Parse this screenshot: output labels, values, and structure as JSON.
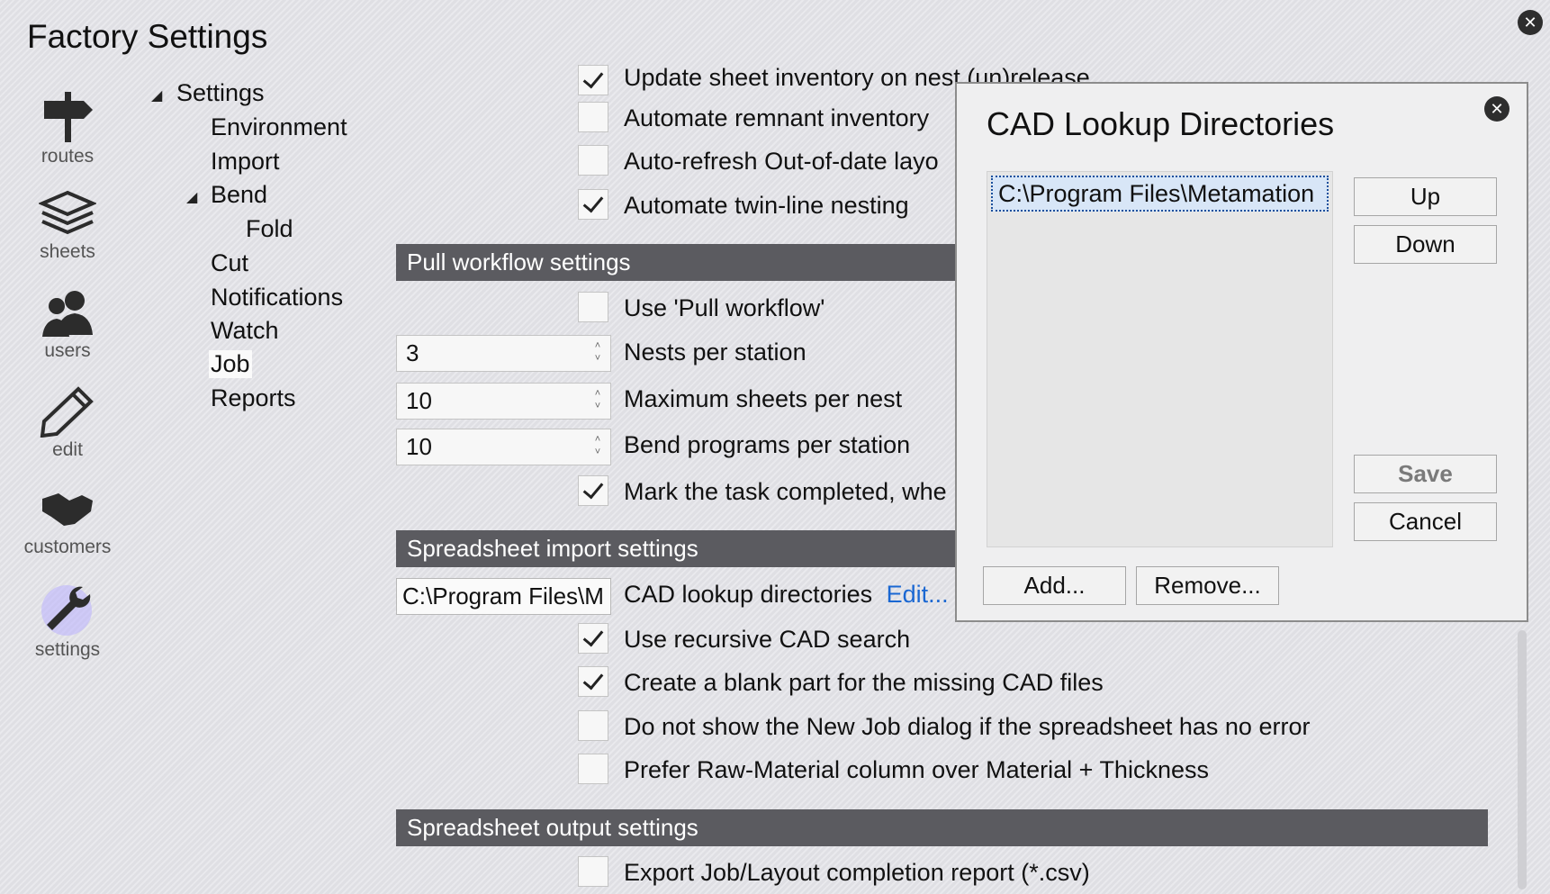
{
  "window": {
    "title": "Factory Settings",
    "close_glyph": "✕"
  },
  "rail": [
    {
      "label": "routes",
      "icon": "signpost-icon"
    },
    {
      "label": "sheets",
      "icon": "stack-icon"
    },
    {
      "label": "users",
      "icon": "users-icon"
    },
    {
      "label": "edit",
      "icon": "pencil-icon"
    },
    {
      "label": "customers",
      "icon": "handshake-icon"
    },
    {
      "label": "settings",
      "icon": "wrench-icon",
      "active": true
    }
  ],
  "tree": {
    "root": "Settings",
    "items": [
      "Environment",
      "Import",
      "Bend",
      "Fold",
      "Cut",
      "Notifications",
      "Watch",
      "Job",
      "Reports"
    ],
    "selected": "Job",
    "expand_glyph": "◢"
  },
  "top_options": [
    {
      "label": "Update sheet inventory on nest (un)release",
      "checked": true
    },
    {
      "label": "Automate remnant inventory",
      "checked": false
    },
    {
      "label": "Auto-refresh Out-of-date layo",
      "checked": false
    },
    {
      "label": "Automate twin-line nesting",
      "checked": true
    }
  ],
  "pull_workflow": {
    "header": "Pull workflow settings",
    "use_pull": {
      "label": "Use 'Pull workflow'",
      "checked": false
    },
    "nests_per_station": {
      "value": "3",
      "label": "Nests per station"
    },
    "max_sheets": {
      "value": "10",
      "label": "Maximum sheets per nest"
    },
    "bend_programs": {
      "value": "10",
      "label": "Bend programs per station"
    },
    "mark_completed": {
      "label": "Mark the task completed, whe",
      "checked": true
    },
    "spin_up": "˄",
    "spin_down": "˅"
  },
  "spreadsheet_import": {
    "header": "Spreadsheet import settings",
    "cad_dir_value": "C:\\Program Files\\M",
    "cad_dir_label": "CAD lookup directories",
    "edit_link": "Edit...",
    "options": [
      {
        "label": "Use recursive CAD search",
        "checked": true
      },
      {
        "label": "Create a blank part for the missing CAD files",
        "checked": true
      },
      {
        "label": "Do not show the New Job dialog if the spreadsheet has no error",
        "checked": false
      },
      {
        "label": "Prefer Raw-Material column over Material + Thickness",
        "checked": false
      }
    ]
  },
  "spreadsheet_output": {
    "header": "Spreadsheet output settings",
    "options": [
      {
        "label": "Export Job/Layout completion report (*.csv)",
        "checked": false
      }
    ]
  },
  "dialog": {
    "title": "CAD Lookup Directories",
    "list_items": [
      "C:\\Program Files\\Metamation"
    ],
    "buttons": {
      "up": "Up",
      "down": "Down",
      "save": "Save",
      "cancel": "Cancel",
      "add": "Add...",
      "remove": "Remove..."
    },
    "close_glyph": "✕"
  },
  "colors": {
    "section_header": "#5b5b60",
    "link": "#1a67d2",
    "active_icon_glow": "#7b6cf0"
  }
}
